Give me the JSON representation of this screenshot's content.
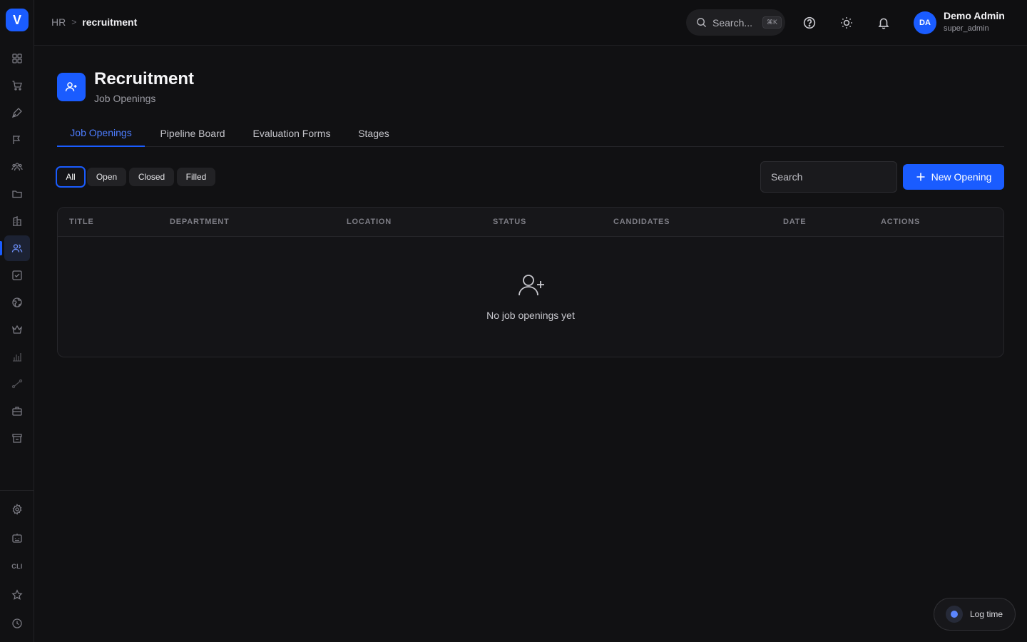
{
  "brand": {
    "logo_letter": "V",
    "accent": "#1a5cff"
  },
  "sidebar": {
    "items": [
      {
        "icon": "grid-icon"
      },
      {
        "icon": "cart-icon"
      },
      {
        "icon": "pen-icon"
      },
      {
        "icon": "send-icon"
      },
      {
        "icon": "team-icon"
      },
      {
        "icon": "folder-icon"
      },
      {
        "icon": "building-icon"
      },
      {
        "icon": "users-icon",
        "active": true
      },
      {
        "icon": "checkbox-icon"
      },
      {
        "icon": "globe-icon"
      },
      {
        "icon": "crown-icon"
      },
      {
        "icon": "bar-chart-icon"
      },
      {
        "icon": "route-icon"
      },
      {
        "icon": "briefcase-icon"
      },
      {
        "icon": "store-icon"
      }
    ],
    "bottom": [
      {
        "icon": "settings-icon"
      },
      {
        "icon": "bot-icon"
      },
      {
        "label": "CLI"
      },
      {
        "icon": "star-icon"
      },
      {
        "icon": "clock-icon"
      }
    ]
  },
  "header": {
    "breadcrumb": {
      "root": "HR",
      "separator": ">",
      "current": "recruitment"
    },
    "search_label": "Search...",
    "search_shortcut": "⌘K",
    "user": {
      "initials": "DA",
      "name": "Demo Admin",
      "role": "super_admin"
    }
  },
  "page": {
    "title": "Recruitment",
    "subtitle": "Job Openings"
  },
  "tabs": [
    {
      "label": "Job Openings",
      "active": true
    },
    {
      "label": "Pipeline Board"
    },
    {
      "label": "Evaluation Forms"
    },
    {
      "label": "Stages"
    }
  ],
  "filters": [
    {
      "label": "All",
      "active": true
    },
    {
      "label": "Open"
    },
    {
      "label": "Closed"
    },
    {
      "label": "Filled"
    }
  ],
  "search": {
    "placeholder": "Search",
    "value": ""
  },
  "new_button": {
    "label": "New Opening"
  },
  "table": {
    "columns": [
      "TITLE",
      "DEPARTMENT",
      "LOCATION",
      "STATUS",
      "CANDIDATES",
      "DATE",
      "ACTIONS"
    ],
    "rows": [],
    "empty_text": "No job openings yet"
  },
  "log_time": {
    "label": "Log time"
  }
}
